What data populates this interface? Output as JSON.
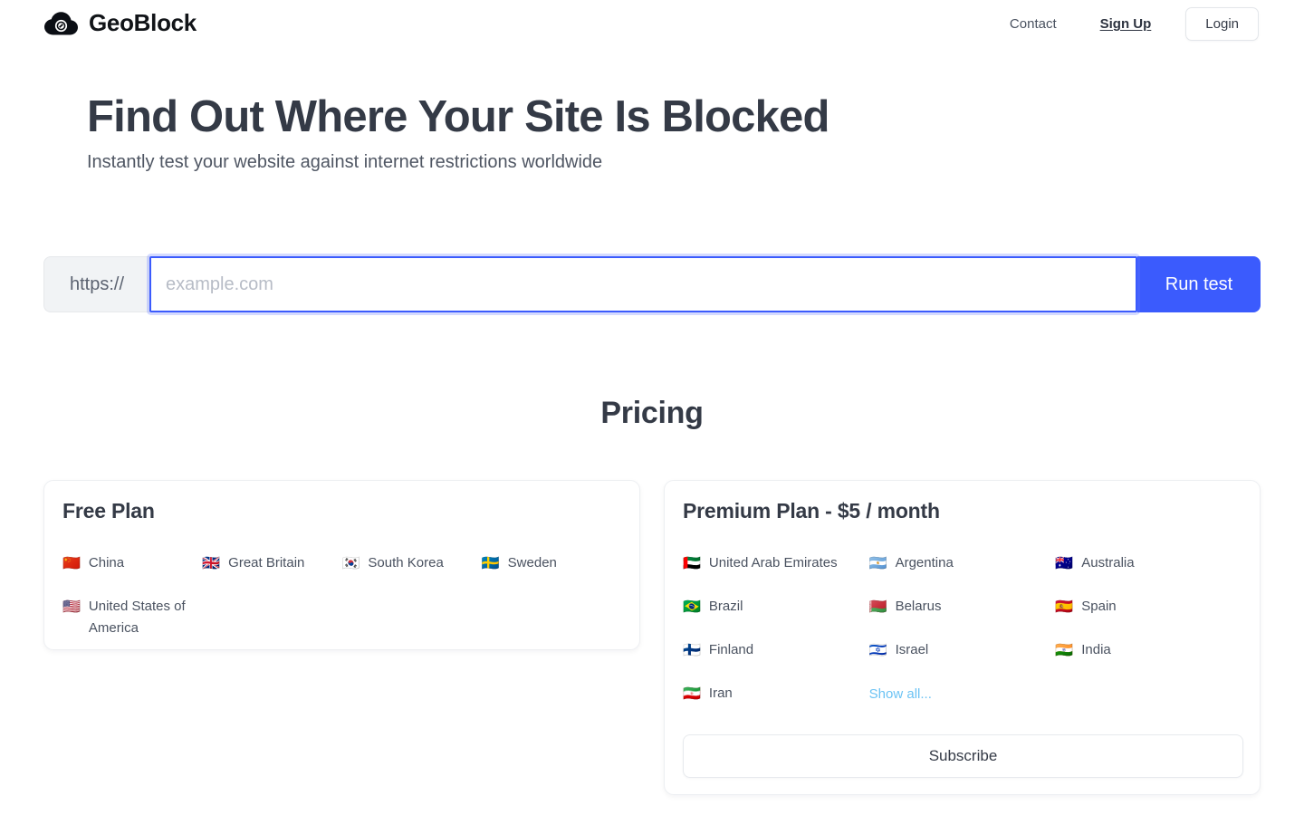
{
  "brand": {
    "name": "GeoBlock",
    "icon": "cloud-block-icon"
  },
  "nav": {
    "contact_label": "Contact",
    "signup_label": "Sign Up",
    "login_label": "Login"
  },
  "hero": {
    "title": "Find Out Where Your Site Is Blocked",
    "subtitle": "Instantly test your website against internet restrictions worldwide"
  },
  "search": {
    "prefix": "https://",
    "value": "",
    "placeholder": "example.com",
    "run_label": "Run test",
    "accent_color": "#3b5bfd"
  },
  "pricing": {
    "title": "Pricing",
    "free": {
      "title": "Free Plan",
      "countries": [
        {
          "flag": "🇨🇳",
          "name": "China"
        },
        {
          "flag": "🇬🇧",
          "name": "Great Britain"
        },
        {
          "flag": "🇰🇷",
          "name": "South Korea"
        },
        {
          "flag": "🇸🇪",
          "name": "Sweden"
        },
        {
          "flag": "🇺🇸",
          "name": "United States of America"
        }
      ]
    },
    "premium": {
      "title": "Premium Plan - $5 / month",
      "countries": [
        {
          "flag": "🇦🇪",
          "name": "United Arab Emirates"
        },
        {
          "flag": "🇦🇷",
          "name": "Argentina"
        },
        {
          "flag": "🇦🇺",
          "name": "Australia"
        },
        {
          "flag": "🇧🇷",
          "name": "Brazil"
        },
        {
          "flag": "🇧🇾",
          "name": "Belarus"
        },
        {
          "flag": "🇪🇸",
          "name": "Spain"
        },
        {
          "flag": "🇫🇮",
          "name": "Finland"
        },
        {
          "flag": "🇮🇱",
          "name": "Israel"
        },
        {
          "flag": "🇮🇳",
          "name": "India"
        },
        {
          "flag": "🇮🇷",
          "name": "Iran"
        }
      ],
      "show_all_label": "Show all...",
      "show_all_color": "#6cc3f4",
      "subscribe_label": "Subscribe"
    }
  }
}
